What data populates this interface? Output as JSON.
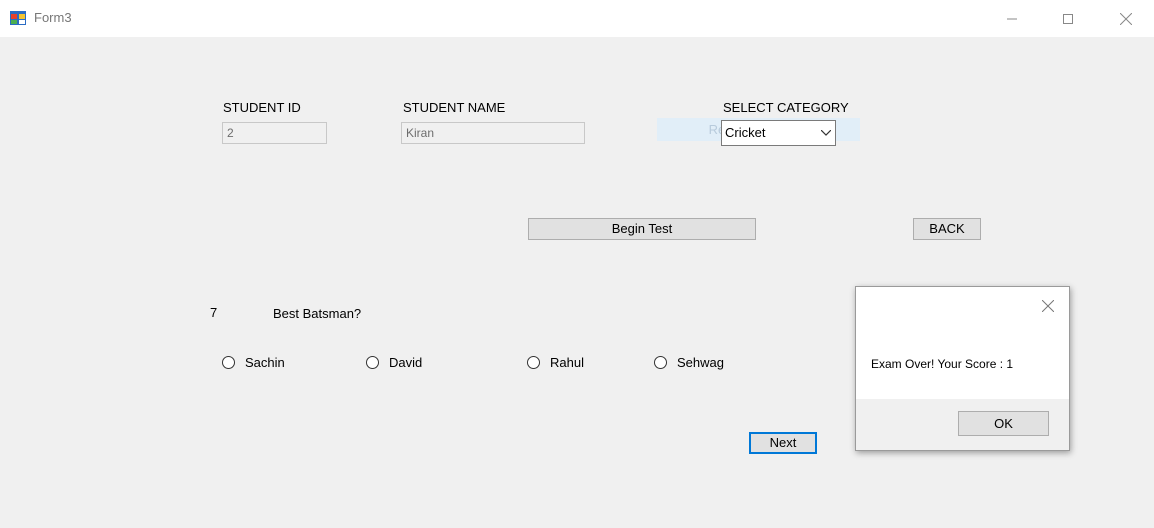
{
  "window": {
    "title": "Form3"
  },
  "form": {
    "student_id_label": "STUDENT ID",
    "student_id_value": "2",
    "student_name_label": "STUDENT NAME",
    "student_name_value": "Kiran",
    "category_label": "SELECT CATEGORY",
    "category_selected": "Cricket",
    "ghost_text": "Rectangular Snip",
    "begin_test_label": "Begin Test",
    "back_label": "BACK",
    "question_number": "7",
    "question_text": "Best Batsman?",
    "options": [
      "Sachin",
      "David",
      "Rahul",
      "Sehwag"
    ],
    "next_label": "Next"
  },
  "dialog": {
    "message": "Exam Over! Your Score : 1",
    "ok_label": "OK"
  }
}
